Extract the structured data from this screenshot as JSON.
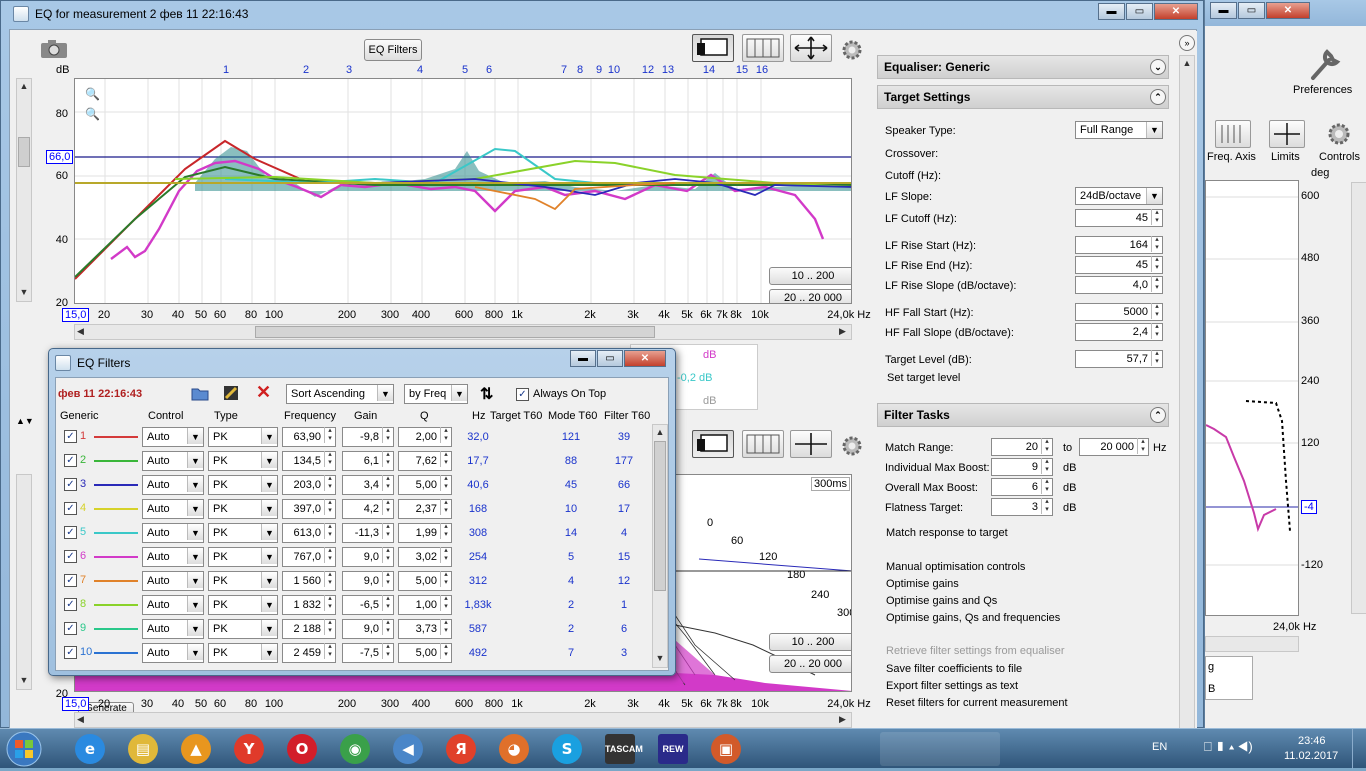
{
  "main_window": {
    "title": "EQ for measurement 2 фев 11 22:16:43",
    "buttons": {
      "minimize": "▬",
      "maximize": "▭",
      "close": "✕"
    }
  },
  "top_graph": {
    "eq_filters_button": "EQ Filters",
    "y_unit": "dB",
    "y_ticks": [
      "80",
      "60",
      "40",
      "20"
    ],
    "y_current": "66,0",
    "x_start": "15,0",
    "x_ticks": [
      "20",
      "30",
      "40",
      "50",
      "60",
      "80",
      "100",
      "200",
      "300",
      "400",
      "600",
      "800",
      "1k",
      "2k",
      "3k",
      "4k",
      "5k",
      "6k",
      "7k",
      "8k",
      "10k",
      "24,0k Hz"
    ],
    "filter_markers": [
      "1",
      "2",
      "3",
      "4",
      "5",
      "6",
      "7",
      "8",
      "9",
      "10",
      "11",
      "12",
      "13",
      "14",
      "15",
      "16"
    ],
    "range_buttons": [
      "10 .. 200",
      "20 .. 20 000"
    ]
  },
  "bottom_graph": {
    "x_start": "15,0",
    "y_tick_visible": "20",
    "x_ticks": [
      "20",
      "30",
      "40",
      "50",
      "60",
      "80",
      "100",
      "200",
      "300",
      "400",
      "600",
      "800",
      "1k",
      "2k",
      "3k",
      "4k",
      "5k",
      "6k",
      "7k",
      "8k",
      "10k",
      "24,0k Hz"
    ],
    "time_label": "300ms",
    "slice_labels": [
      "0",
      "60",
      "120",
      "180",
      "240",
      "300"
    ],
    "range_buttons": [
      "10 .. 200",
      "20 .. 20 000"
    ],
    "generate_button": "Generate"
  },
  "behind_overlay": {
    "labels": [
      "dB",
      "-0,2 dB",
      "dB"
    ]
  },
  "right_panel": {
    "equaliser_header": "Equaliser: Generic",
    "target_header": "Target Settings",
    "target": {
      "speaker_type_label": "Speaker Type:",
      "speaker_type_value": "Full Range",
      "crossover_label": "Crossover:",
      "cutoff_label": "Cutoff (Hz):",
      "lf_slope_label": "LF Slope:",
      "lf_slope_value": "24dB/octave",
      "lf_cutoff_label": "LF Cutoff (Hz):",
      "lf_cutoff_value": "45",
      "lf_rise_start_label": "LF Rise Start (Hz):",
      "lf_rise_start_value": "164",
      "lf_rise_end_label": "LF Rise End (Hz):",
      "lf_rise_end_value": "45",
      "lf_rise_slope_label": "LF Rise Slope (dB/octave):",
      "lf_rise_slope_value": "4,0",
      "hf_fall_start_label": "HF Fall Start (Hz):",
      "hf_fall_start_value": "5000",
      "hf_fall_slope_label": "HF Fall Slope (dB/octave):",
      "hf_fall_slope_value": "2,4",
      "target_level_label": "Target Level (dB):",
      "target_level_value": "57,7",
      "set_target_level": "Set target level"
    },
    "filter_tasks_header": "Filter Tasks",
    "tasks": {
      "match_range_label": "Match Range:",
      "match_range_from": "20",
      "to_label": "to",
      "match_range_to": "20 000",
      "hz_label": "Hz",
      "indiv_boost_label": "Individual Max Boost:",
      "indiv_boost_value": "9",
      "overall_boost_label": "Overall Max Boost:",
      "overall_boost_value": "6",
      "flatness_label": "Flatness Target:",
      "flatness_value": "3",
      "db_unit": "dB",
      "match_response": "Match response to target",
      "manual_opt": "Manual optimisation controls",
      "opt_gains": "Optimise gains",
      "opt_gains_qs": "Optimise gains and Qs",
      "opt_gains_qs_freq": "Optimise gains, Qs and frequencies",
      "retrieve": "Retrieve filter settings from equaliser",
      "save_coeffs": "Save filter coefficients to file",
      "export": "Export filter settings as text",
      "reset": "Reset filters for current measurement"
    }
  },
  "back_window": {
    "preferences": "Preferences",
    "freq_axis": "Freq. Axis",
    "limits": "Limits",
    "controls": "Controls",
    "unit": "deg",
    "y_ticks": [
      "600",
      "480",
      "360",
      "240",
      "120",
      "-4",
      "-120"
    ],
    "x_end": "24,0k Hz",
    "partial_g": "g",
    "partial_b": "B"
  },
  "eq_dialog": {
    "title": "EQ Filters",
    "timestamp": "фев 11 22:16:43",
    "sort_value": "Sort Ascending",
    "by_value": "by Freq",
    "always_on_top": "Always On Top",
    "columns": [
      "Generic",
      "Control",
      "Type",
      "Frequency",
      "Gain",
      "Q",
      "Hz",
      "Target T60",
      "Mode T60",
      "Filter T60"
    ],
    "rows": [
      {
        "n": "1",
        "color": "#d43a3a",
        "control": "Auto",
        "type": "PK",
        "freq": "63,90",
        "gain": "-9,8",
        "q": "2,00",
        "hz": "32,0",
        "mode": "121",
        "filter": "39"
      },
      {
        "n": "2",
        "color": "#3ab63a",
        "control": "Auto",
        "type": "PK",
        "freq": "134,5",
        "gain": "6,1",
        "q": "7,62",
        "hz": "17,7",
        "mode": "88",
        "filter": "177"
      },
      {
        "n": "3",
        "color": "#2a2ab8",
        "control": "Auto",
        "type": "PK",
        "freq": "203,0",
        "gain": "3,4",
        "q": "5,00",
        "hz": "40,6",
        "mode": "45",
        "filter": "66"
      },
      {
        "n": "4",
        "color": "#d6d22a",
        "control": "Auto",
        "type": "PK",
        "freq": "397,0",
        "gain": "4,2",
        "q": "2,37",
        "hz": "168",
        "mode": "10",
        "filter": "17"
      },
      {
        "n": "5",
        "color": "#3ac8c8",
        "control": "Auto",
        "type": "PK",
        "freq": "613,0",
        "gain": "-11,3",
        "q": "1,99",
        "hz": "308",
        "mode": "14",
        "filter": "4"
      },
      {
        "n": "6",
        "color": "#d23ac8",
        "control": "Auto",
        "type": "PK",
        "freq": "767,0",
        "gain": "9,0",
        "q": "3,02",
        "hz": "254",
        "mode": "5",
        "filter": "15"
      },
      {
        "n": "7",
        "color": "#e0822a",
        "control": "Auto",
        "type": "PK",
        "freq": "1 560",
        "gain": "9,0",
        "q": "5,00",
        "hz": "312",
        "mode": "4",
        "filter": "12"
      },
      {
        "n": "8",
        "color": "#8ad22a",
        "control": "Auto",
        "type": "PK",
        "freq": "1 832",
        "gain": "-6,5",
        "q": "1,00",
        "hz": "1,83k",
        "mode": "2",
        "filter": "1"
      },
      {
        "n": "9",
        "color": "#2ac88a",
        "control": "Auto",
        "type": "PK",
        "freq": "2 188",
        "gain": "9,0",
        "q": "3,73",
        "hz": "587",
        "mode": "2",
        "filter": "6"
      },
      {
        "n": "10",
        "color": "#2a72d2",
        "control": "Auto",
        "type": "PK",
        "freq": "2 459",
        "gain": "-7,5",
        "q": "5,00",
        "hz": "492",
        "mode": "7",
        "filter": "3"
      }
    ]
  },
  "taskbar": {
    "apps": [
      {
        "name": "ie",
        "glyph": "e",
        "color": "#2a8ae0"
      },
      {
        "name": "explorer",
        "glyph": "▤",
        "color": "#e0b83a"
      },
      {
        "name": "aimp",
        "glyph": "▲",
        "color": "#e8961e"
      },
      {
        "name": "yandex-browser",
        "glyph": "Y",
        "color": "#e03a2a"
      },
      {
        "name": "opera",
        "glyph": "O",
        "color": "#d21e2a"
      },
      {
        "name": "chrome",
        "glyph": "◉",
        "color": "#3aa04a"
      },
      {
        "name": "volume",
        "glyph": "◀",
        "color": "#4a86c8"
      },
      {
        "name": "yandex",
        "glyph": "Я",
        "color": "#e0402a"
      },
      {
        "name": "firefox",
        "glyph": "◕",
        "color": "#e0702a"
      },
      {
        "name": "skype",
        "glyph": "S",
        "color": "#1aa0e0"
      },
      {
        "name": "tascam",
        "glyph": "TASCAM",
        "color": "#333333"
      },
      {
        "name": "rew",
        "glyph": "REW",
        "color": "#2a2a8a"
      },
      {
        "name": "presentation",
        "glyph": "▣",
        "color": "#d25a2a"
      }
    ],
    "lang": "EN",
    "time": "23:46",
    "date": "11.02.2017"
  },
  "colors": {
    "target_line": "#1a1a8a",
    "measurement": "#d23ac8",
    "predicted": "#2a6a6a"
  }
}
